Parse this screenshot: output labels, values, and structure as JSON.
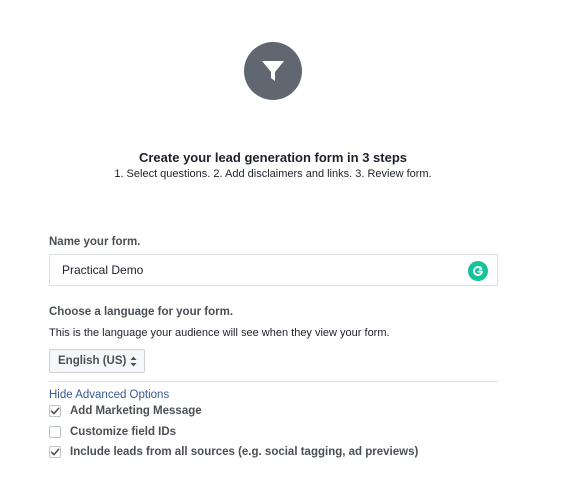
{
  "header": {
    "icon": "funnel-icon",
    "title": "Create your lead generation form in 3 steps",
    "subtitle": "1. Select questions. 2. Add disclaimers and links. 3. Review form."
  },
  "name_section": {
    "label": "Name your form.",
    "value": "Practical Demo",
    "badge_icon": "grammarly-icon"
  },
  "language_section": {
    "label": "Choose a language for your form.",
    "description": "This is the language your audience will see when they view your form.",
    "selected": "English (US)"
  },
  "advanced": {
    "toggle_label": "Hide Advanced Options",
    "options": [
      {
        "label": "Add Marketing Message",
        "checked": true
      },
      {
        "label": "Customize field IDs",
        "checked": false
      },
      {
        "label": "Include leads from all sources (e.g. social tagging, ad previews)",
        "checked": true
      }
    ]
  },
  "colors": {
    "badge_bg": "#606770",
    "link": "#365899",
    "grammarly": "#15c39a"
  }
}
